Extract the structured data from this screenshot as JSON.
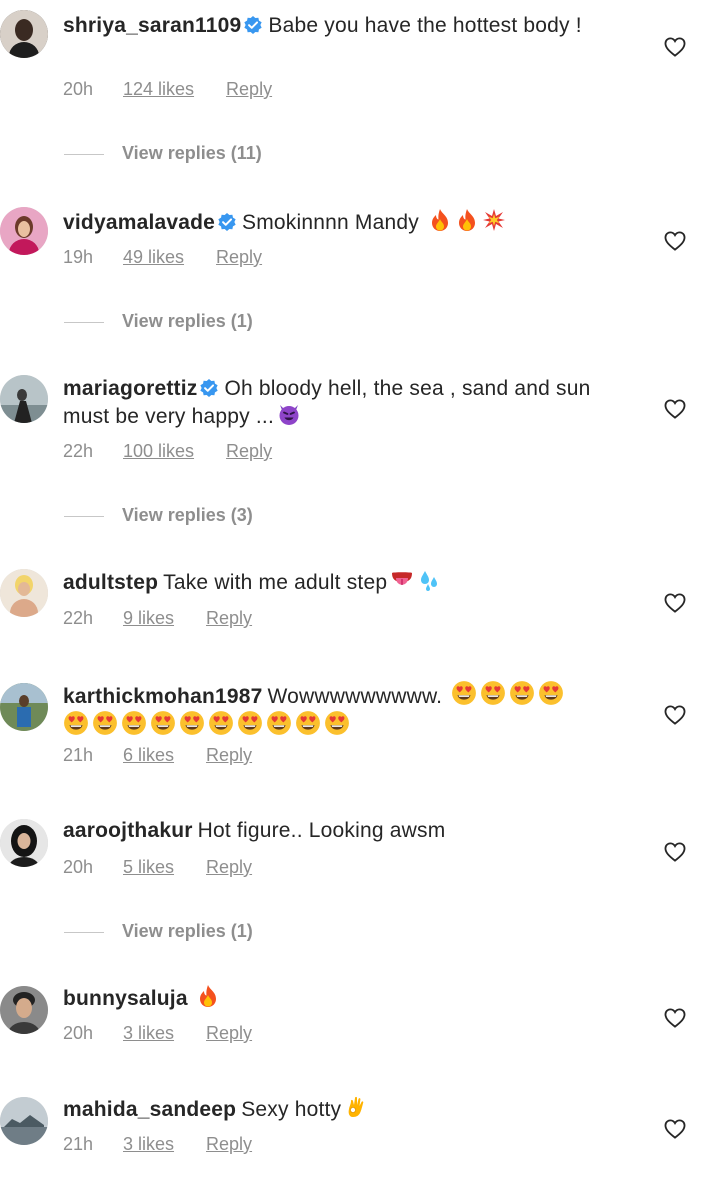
{
  "comments": [
    {
      "username": "shriya_saran1109",
      "verified": true,
      "text": "Babe you have the hottest body !",
      "time": "20h",
      "likes": "124 likes",
      "reply": "Reply",
      "view_replies": "View replies (11)",
      "avatar_color": "#3a3a3a",
      "heart_icon": "heart-outline-icon"
    },
    {
      "username": "vidyamalavade",
      "verified": true,
      "text": "Smokinnnn Mandy",
      "emojis": [
        "fire",
        "fire",
        "collision"
      ],
      "time": "19h",
      "likes": "49 likes",
      "reply": "Reply",
      "view_replies": "View replies (1)",
      "avatar_color": "#c96a9a",
      "heart_icon": "heart-outline-icon"
    },
    {
      "username": "mariagorettiz",
      "verified": true,
      "text": "Oh bloody hell, the sea , sand and sun must be very happy ...",
      "emojis": [
        "smiling-devil"
      ],
      "time": "22h",
      "likes": "100 likes",
      "reply": "Reply",
      "view_replies": "View replies (3)",
      "avatar_color": "#7d8a8f",
      "heart_icon": "heart-outline-icon"
    },
    {
      "username": "adultstep",
      "verified": false,
      "text": "Take with me adult step",
      "emojis": [
        "tongue",
        "sweat-droplets"
      ],
      "time": "22h",
      "likes": "9 likes",
      "reply": "Reply",
      "avatar_color": "#d9b89c",
      "heart_icon": "heart-outline-icon"
    },
    {
      "username": "karthickmohan1987",
      "verified": false,
      "text": "Wowwwwwwwww.",
      "emojis": [
        "heart-eyes",
        "heart-eyes",
        "heart-eyes",
        "heart-eyes",
        "heart-eyes",
        "heart-eyes",
        "heart-eyes",
        "heart-eyes",
        "heart-eyes",
        "heart-eyes",
        "heart-eyes",
        "heart-eyes",
        "heart-eyes",
        "heart-eyes"
      ],
      "time": "21h",
      "likes": "6 likes",
      "reply": "Reply",
      "avatar_color": "#5a7a4a",
      "heart_icon": "heart-outline-icon"
    },
    {
      "username": "aaroojthakur",
      "verified": false,
      "text": "Hot figure.. Looking awsm",
      "time": "20h",
      "likes": "5 likes",
      "reply": "Reply",
      "view_replies": "View replies (1)",
      "avatar_color": "#2a2a2a",
      "heart_icon": "heart-outline-icon"
    },
    {
      "username": "bunnysaluja",
      "verified": false,
      "text": "",
      "emojis": [
        "fire"
      ],
      "time": "20h",
      "likes": "3 likes",
      "reply": "Reply",
      "avatar_color": "#6c6c6c",
      "heart_icon": "heart-outline-icon"
    },
    {
      "username": "mahida_sandeep",
      "verified": false,
      "text": "Sexy hotty",
      "emojis": [
        "ok-hand"
      ],
      "time": "21h",
      "likes": "3 likes",
      "reply": "Reply",
      "avatar_color": "#9aa6ad",
      "heart_icon": "heart-outline-icon"
    }
  ],
  "colors": {
    "verified": "#3897f0",
    "meta": "#8e8e8e",
    "text": "#262626"
  }
}
